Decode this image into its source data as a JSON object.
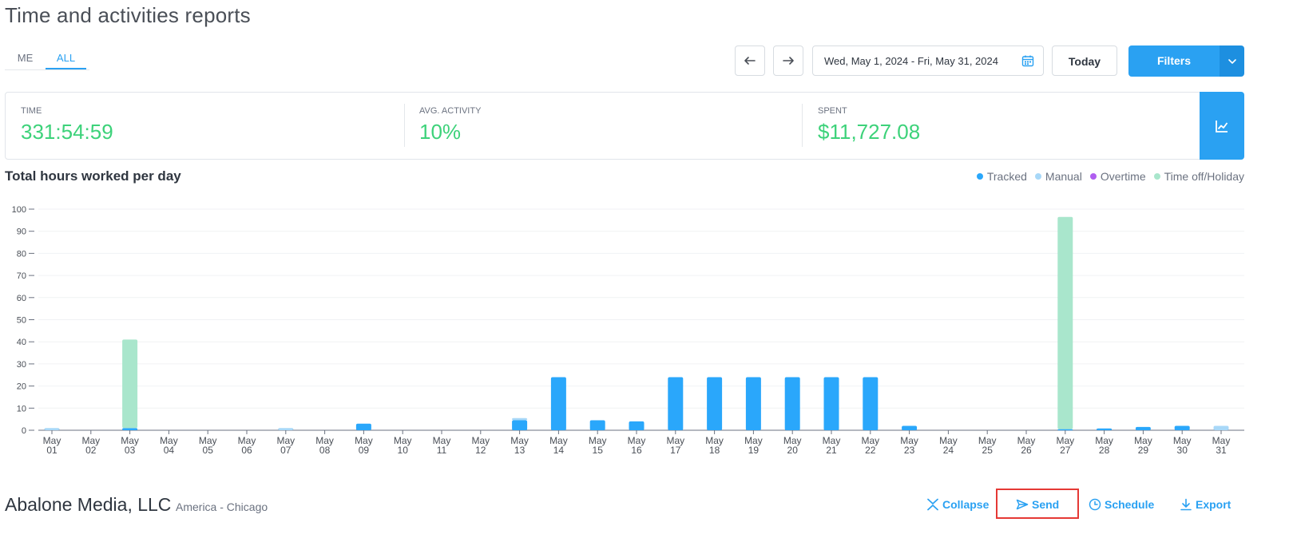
{
  "page": {
    "title": "Time and activities reports"
  },
  "tabs": [
    {
      "label": "ME",
      "active": false
    },
    {
      "label": "ALL",
      "active": true
    }
  ],
  "toolbar": {
    "date_range": "Wed, May 1, 2024 - Fri, May 31, 2024",
    "today_label": "Today",
    "filters_label": "Filters"
  },
  "summary": {
    "time_label": "TIME",
    "time_value": "331:54:59",
    "activity_label": "AVG. ACTIVITY",
    "activity_value": "10%",
    "spent_label": "SPENT",
    "spent_value": "$11,727.08"
  },
  "colors": {
    "accent": "#2aa1f2",
    "tracked": "#2aa7fb",
    "manual": "#a8d8f8",
    "overtime": "#b05ef0",
    "timeoff": "#a9e6cc",
    "positive": "#3dd27a",
    "highlight": "#e53935"
  },
  "chart_data": {
    "type": "bar",
    "title": "Total hours worked per day",
    "stacked": true,
    "ylim": [
      0,
      100
    ],
    "yticks": [
      0,
      10,
      20,
      30,
      40,
      50,
      60,
      70,
      80,
      90,
      100
    ],
    "categories": [
      "May 01",
      "May 02",
      "May 03",
      "May 04",
      "May 05",
      "May 06",
      "May 07",
      "May 08",
      "May 09",
      "May 10",
      "May 11",
      "May 12",
      "May 13",
      "May 14",
      "May 15",
      "May 16",
      "May 17",
      "May 18",
      "May 19",
      "May 20",
      "May 21",
      "May 22",
      "May 23",
      "May 24",
      "May 25",
      "May 26",
      "May 27",
      "May 28",
      "May 29",
      "May 30",
      "May 31"
    ],
    "series": [
      {
        "name": "Tracked",
        "color": "#2aa7fb",
        "values": [
          0,
          0,
          1,
          0,
          0,
          0,
          0,
          0,
          3,
          0,
          0,
          0,
          4.5,
          24,
          4.5,
          4,
          24,
          24,
          24,
          24,
          24,
          24,
          2,
          0,
          0,
          0,
          0.5,
          0.8,
          1.5,
          2,
          0
        ]
      },
      {
        "name": "Manual",
        "color": "#a8d8f8",
        "values": [
          1,
          0,
          0,
          0,
          0,
          0,
          1,
          0,
          0,
          0,
          0,
          0,
          1,
          0,
          0,
          0,
          0,
          0,
          0,
          0,
          0,
          0,
          0,
          0,
          0,
          0,
          0,
          0,
          0,
          0,
          2
        ]
      },
      {
        "name": "Overtime",
        "color": "#b05ef0",
        "values": [
          0,
          0,
          0,
          0,
          0,
          0,
          0,
          0,
          0,
          0,
          0,
          0,
          0,
          0,
          0,
          0,
          0,
          0,
          0,
          0,
          0,
          0,
          0,
          0,
          0,
          0,
          0,
          0,
          0,
          0,
          0
        ]
      },
      {
        "name": "Time off/Holiday",
        "color": "#a9e6cc",
        "values": [
          0,
          0,
          40,
          0,
          0,
          0,
          0,
          0,
          0,
          0,
          0,
          0,
          0,
          0,
          0,
          0,
          0,
          0,
          0,
          0,
          0,
          0,
          0,
          0,
          0,
          0,
          96,
          0,
          0,
          0,
          0
        ]
      }
    ],
    "grid": true,
    "legend": "top-right"
  },
  "company": {
    "name": "Abalone Media, LLC",
    "timezone": "America - Chicago"
  },
  "actions": {
    "collapse": "Collapse",
    "send": "Send",
    "schedule": "Schedule",
    "export": "Export"
  }
}
